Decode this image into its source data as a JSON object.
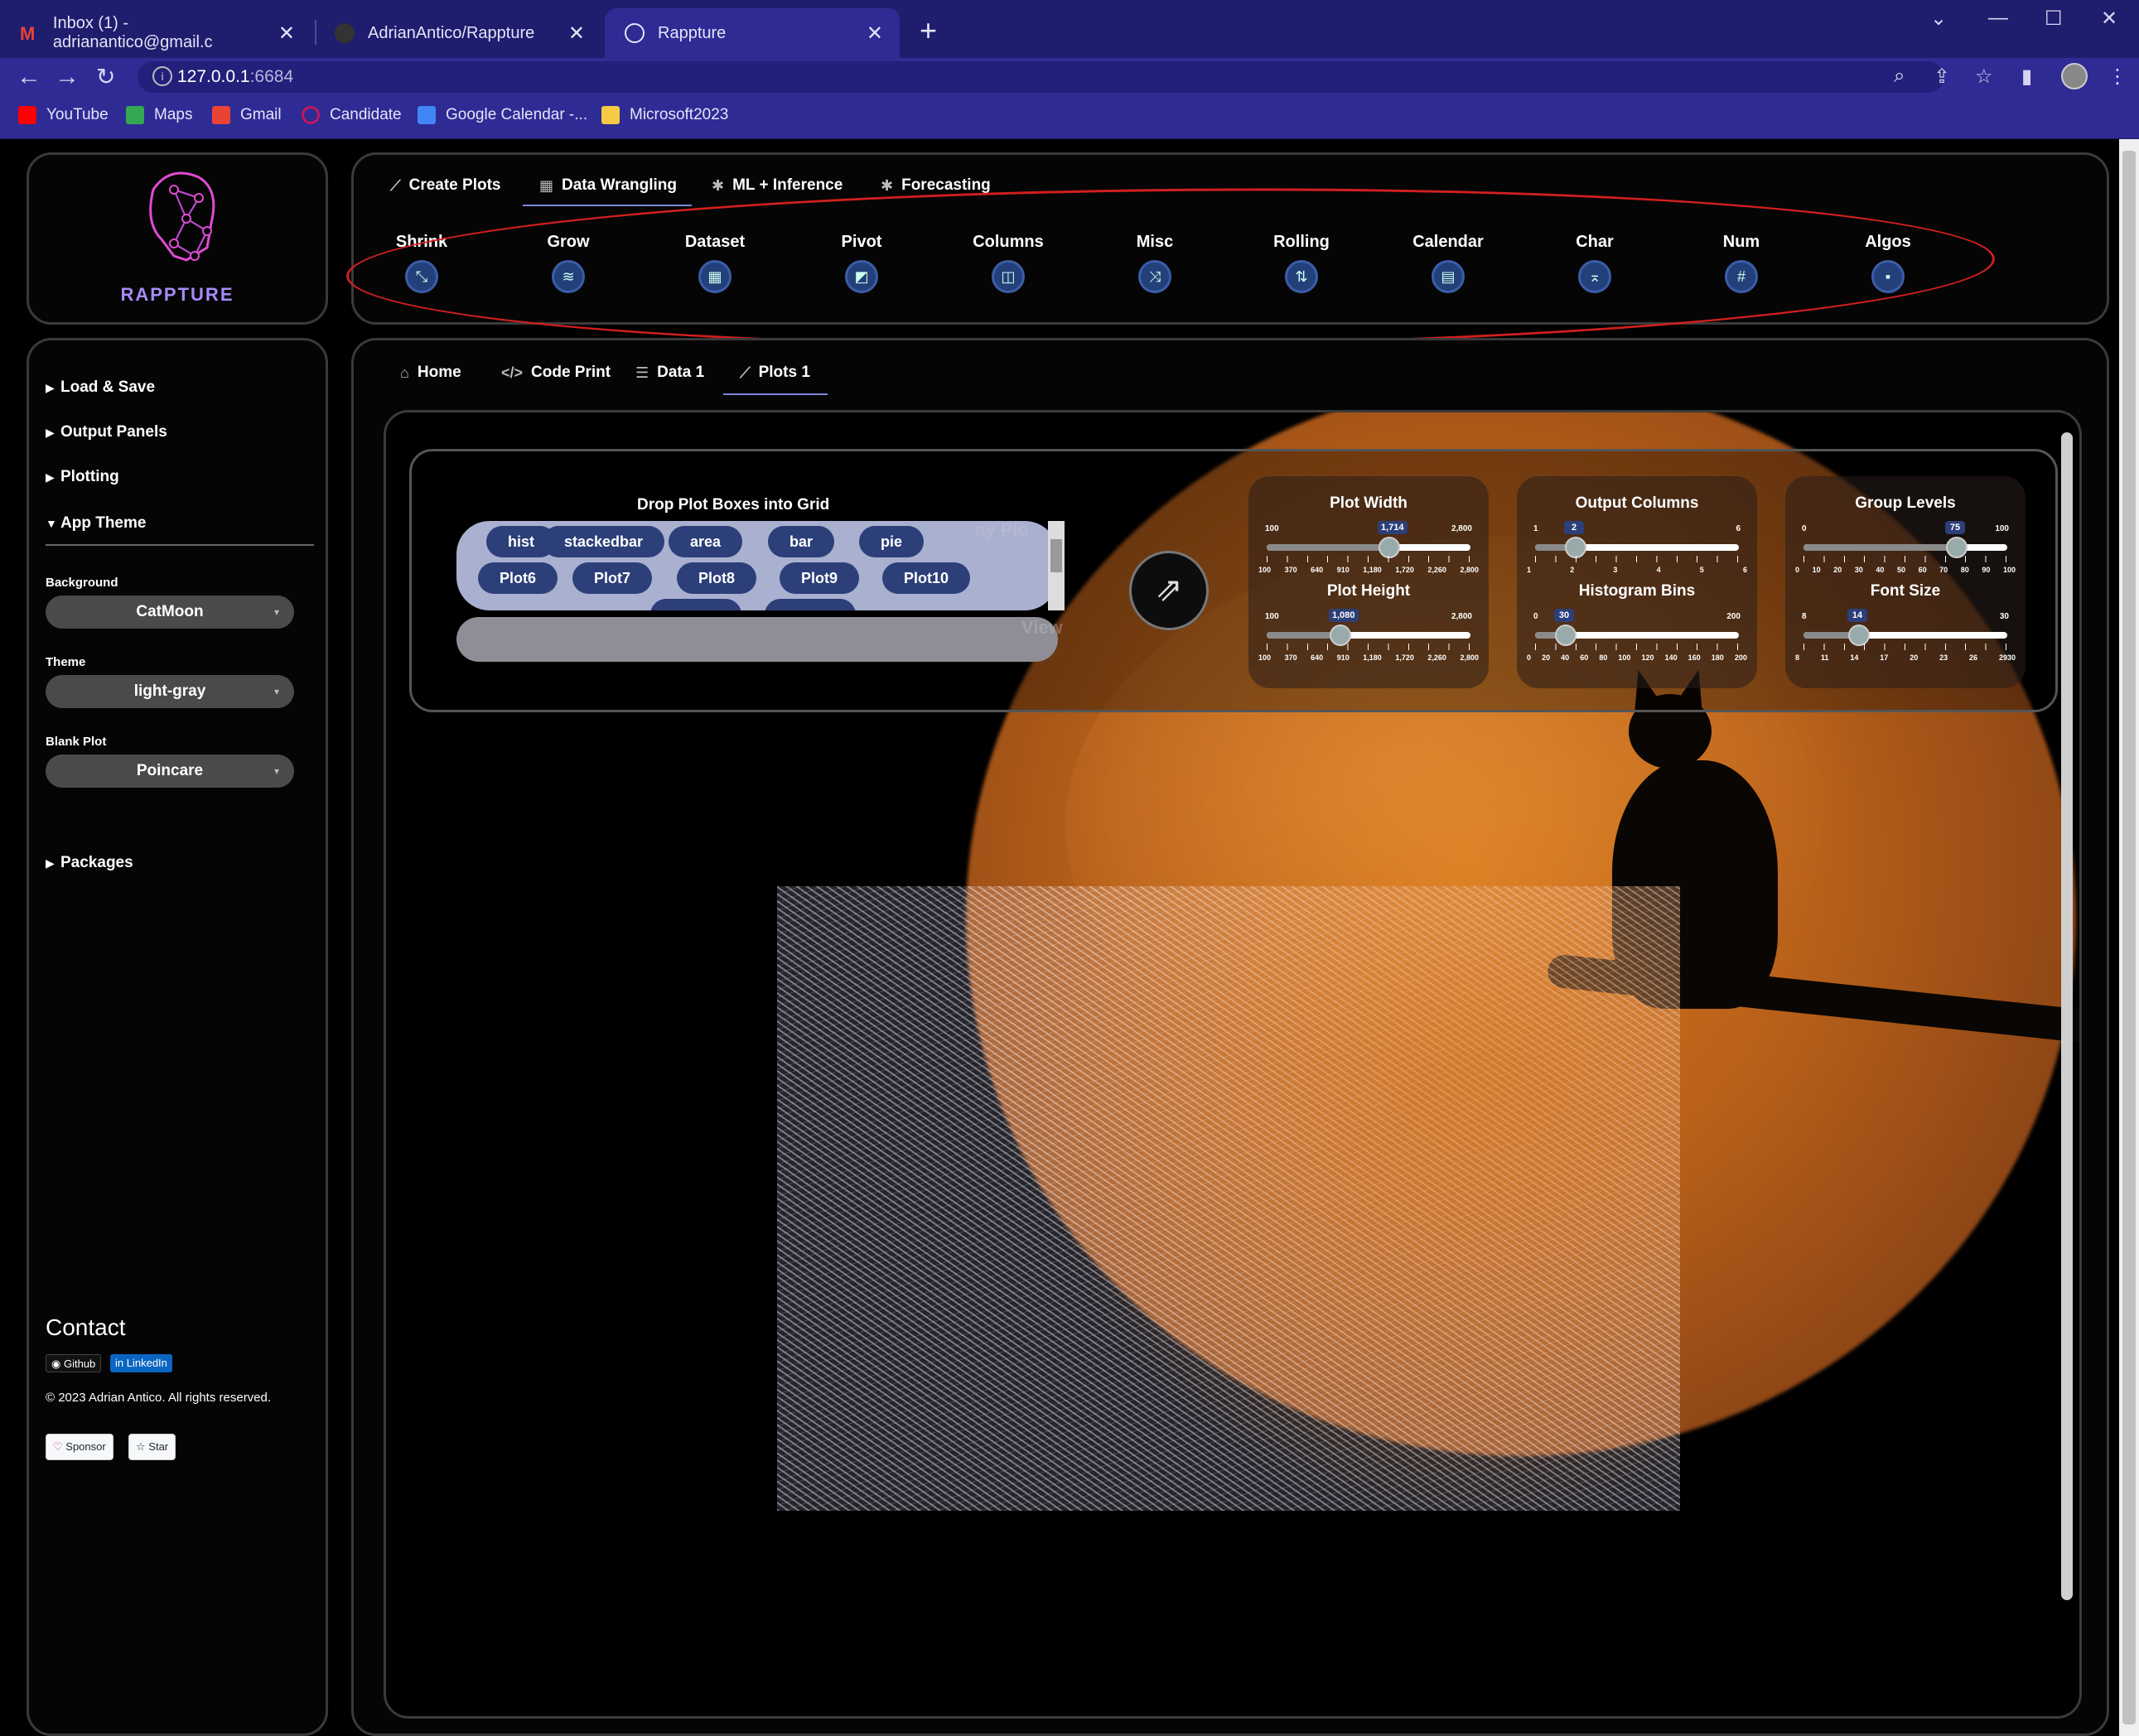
{
  "browser": {
    "tabs": [
      {
        "title": "Inbox (1) - adrianantico@gmail.c",
        "icon": "gmail-icon"
      },
      {
        "title": "AdrianAntico/Rappture",
        "icon": "github-icon"
      },
      {
        "title": "Rappture",
        "icon": "globe-icon"
      }
    ],
    "url_host": "127.0.0.1",
    "url_port": ":6684",
    "bookmarks": [
      "YouTube",
      "Maps",
      "Gmail",
      "Candidate",
      "Google Calendar -...",
      "Microsoft2023"
    ]
  },
  "logo": {
    "text": "RAPPTURE"
  },
  "top_tabs": [
    "Create Plots",
    "Data Wrangling",
    "ML + Inference",
    "Forecasting"
  ],
  "ribbon": [
    "Shrink",
    "Grow",
    "Dataset",
    "Pivot",
    "Columns",
    "Misc",
    "Rolling",
    "Calendar",
    "Char",
    "Num",
    "Algos"
  ],
  "sidebar": {
    "sections": [
      "Load & Save",
      "Output Panels",
      "Plotting",
      "App Theme"
    ],
    "packages": "Packages",
    "background_label": "Background",
    "background_value": "CatMoon",
    "theme_label": "Theme",
    "theme_value": "light-gray",
    "blank_plot_label": "Blank Plot",
    "blank_plot_value": "Poincare",
    "contact_title": "Contact",
    "github_badge": "Github",
    "linkedin_badge": "LinkedIn",
    "copyright": "© 2023 Adrian Antico. All rights reserved.",
    "sponsor": "Sponsor",
    "star": "Star"
  },
  "sub_tabs": [
    "Home",
    "Code Print",
    "Data 1",
    "Plots 1"
  ],
  "drop": {
    "title": "Drop Plot Boxes into Grid",
    "row1": [
      "hist",
      "stackedbar",
      "area",
      "bar",
      "pie"
    ],
    "row2": [
      "Plot6",
      "Plot7",
      "Plot8",
      "Plot9",
      "Plot10"
    ],
    "ghost1": "ay Plo",
    "ghost2": "View"
  },
  "sliders": {
    "plot_width": {
      "title": "Plot Width",
      "min": "100",
      "max": "2,800",
      "value": "1,714",
      "ticks": [
        "100",
        "370",
        "640",
        "910",
        "1,180",
        "1,720",
        "2,260",
        "2,800"
      ]
    },
    "plot_height": {
      "title": "Plot Height",
      "min": "100",
      "max": "2,800",
      "value": "1,080",
      "ticks": [
        "100",
        "370",
        "640",
        "910",
        "1,180",
        "1,720",
        "2,260",
        "2,800"
      ]
    },
    "output_columns": {
      "title": "Output Columns",
      "min": "1",
      "max": "6",
      "value": "2",
      "ticks": [
        "1",
        "2",
        "3",
        "4",
        "5",
        "6"
      ]
    },
    "histogram_bins": {
      "title": "Histogram Bins",
      "min": "0",
      "max": "200",
      "value": "30",
      "ticks": [
        "0",
        "20",
        "40",
        "60",
        "80",
        "100",
        "120",
        "140",
        "160",
        "180",
        "200"
      ]
    },
    "group_levels": {
      "title": "Group Levels",
      "min": "0",
      "max": "100",
      "value": "75",
      "ticks": [
        "0",
        "10",
        "20",
        "30",
        "40",
        "50",
        "60",
        "70",
        "80",
        "90",
        "100"
      ]
    },
    "font_size": {
      "title": "Font Size",
      "min": "8",
      "max": "30",
      "value": "14",
      "ticks": [
        "8",
        "11",
        "14",
        "17",
        "20",
        "23",
        "26",
        "2930"
      ]
    }
  },
  "levels": {
    "plot_width": 0.6,
    "plot_height": 0.363,
    "output_columns": 0.2,
    "histogram_bins": 0.15,
    "group_levels": 0.75,
    "font_size": 0.273
  },
  "colors": {
    "accent": "#2c3f79",
    "annotation": "#d21f1f",
    "moon": "#d6761a"
  }
}
